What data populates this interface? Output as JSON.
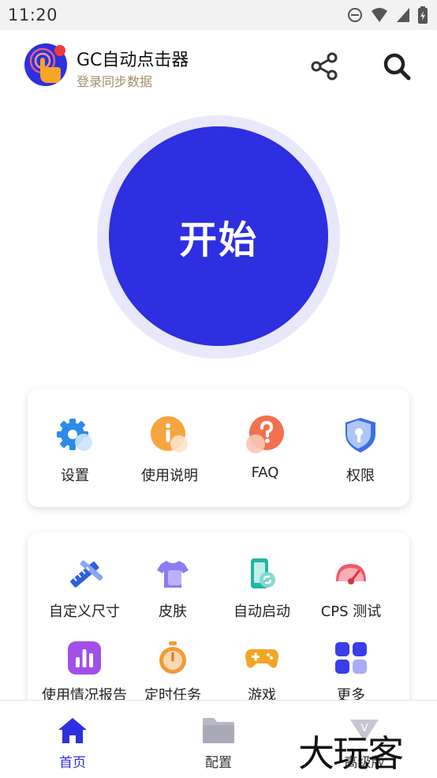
{
  "status_bar": {
    "time": "11:20"
  },
  "header": {
    "title": "GC自动点击器",
    "subtitle": "登录同步数据"
  },
  "start_button": {
    "label": "开始"
  },
  "quick_menu": [
    {
      "label": "设置",
      "icon": "gear-icon"
    },
    {
      "label": "使用说明",
      "icon": "info-icon"
    },
    {
      "label": "FAQ",
      "icon": "question-icon"
    },
    {
      "label": "权限",
      "icon": "shield-key-icon"
    }
  ],
  "features": [
    {
      "label": "自定义尺寸",
      "icon": "ruler-pencil-icon"
    },
    {
      "label": "皮肤",
      "icon": "tshirt-icon"
    },
    {
      "label": "自动启动",
      "icon": "phone-link-icon"
    },
    {
      "label": "CPS 测试",
      "icon": "speedometer-icon"
    },
    {
      "label": "使用情况报告",
      "icon": "bar-chart-icon"
    },
    {
      "label": "定时任务",
      "icon": "stopwatch-icon"
    },
    {
      "label": "游戏",
      "icon": "gamepad-icon"
    },
    {
      "label": "更多",
      "icon": "grid-icon"
    }
  ],
  "bottom_nav": [
    {
      "label": "首页",
      "icon": "home-icon",
      "active": true
    },
    {
      "label": "配置",
      "icon": "folder-icon",
      "active": false
    },
    {
      "label": "高级版",
      "icon": "vip-icon",
      "active": false
    }
  ],
  "watermark": "大玩客",
  "colors": {
    "primary": "#2d2fe0",
    "ring": "#e9e8fb",
    "subtitle": "#a08e67"
  }
}
